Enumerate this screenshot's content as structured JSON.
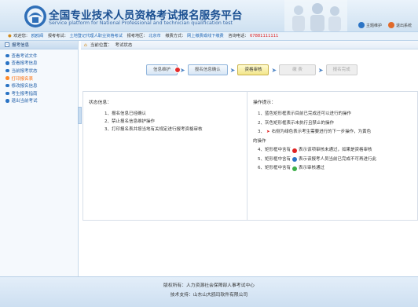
{
  "header": {
    "title": "全国专业技术人员资格考试报名服务平台",
    "subtitle": "Service platform for National Professional and technician qualification test",
    "link_home": "主题维护",
    "link_exit": "退出系统",
    "colors": {
      "title": "#1a4f91",
      "accent": "#2b74c5"
    }
  },
  "infobar": {
    "welcome_label": "欢迎您：",
    "welcome_value": "鸥鸥阀",
    "exam_label": "报考考试：",
    "exam_value": "土地登记代理人职业资格考试",
    "area_label": "报考地区：",
    "area_value": "北京市",
    "pay_label": "缴费方式：",
    "pay_value": "网上缴费或线下缴费",
    "phone_label": "咨询电话：",
    "phone_value": "67881111111"
  },
  "sidebar": {
    "header": "报考信息",
    "items": [
      {
        "label": "查看考试文件"
      },
      {
        "label": "查看报考信息"
      },
      {
        "label": "当前报考状态"
      },
      {
        "label": "打印报名表"
      },
      {
        "label": "修改报名信息"
      },
      {
        "label": "考生报考指南"
      },
      {
        "label": "退出当前考试"
      }
    ]
  },
  "main": {
    "breadcrumb_label": "当前位置：",
    "breadcrumb_value": "考试状态",
    "steps": [
      {
        "label": "信息维护"
      },
      {
        "label": "报名信息确认"
      },
      {
        "label": "资格审核"
      },
      {
        "label": "缴 费"
      },
      {
        "label": "报名完成"
      }
    ],
    "status": {
      "title": "状态信息：",
      "lines": [
        "1、报名信息已经确认",
        "2、禁止报名信息维护操作",
        "3、打印报名表并按当地有关规定进行报考资格审核"
      ]
    },
    "ops": {
      "title": "操作提示：",
      "lines": [
        "1、蓝色矩形框表示目前已完成还可以进行的操作",
        "2、灰色矩形框表示未执行且禁止的操作",
        "3、",
        "右侧为绿色表示考生需要进行的下一步操作，为黄色",
        "的操作",
        "4、矩形框中含有",
        "表示该项审核未通过，如果是资格审核",
        "5、矩形框中含有",
        "表示该报考人员当前已完成不可再进行此",
        "6、矩形框中含有",
        "表示审核通过"
      ]
    }
  },
  "footer": {
    "copyright": "版权所有：人力资源社会保障部人事考试中心",
    "support": "技术支持：山东山大鸥玛软件有限公司"
  }
}
